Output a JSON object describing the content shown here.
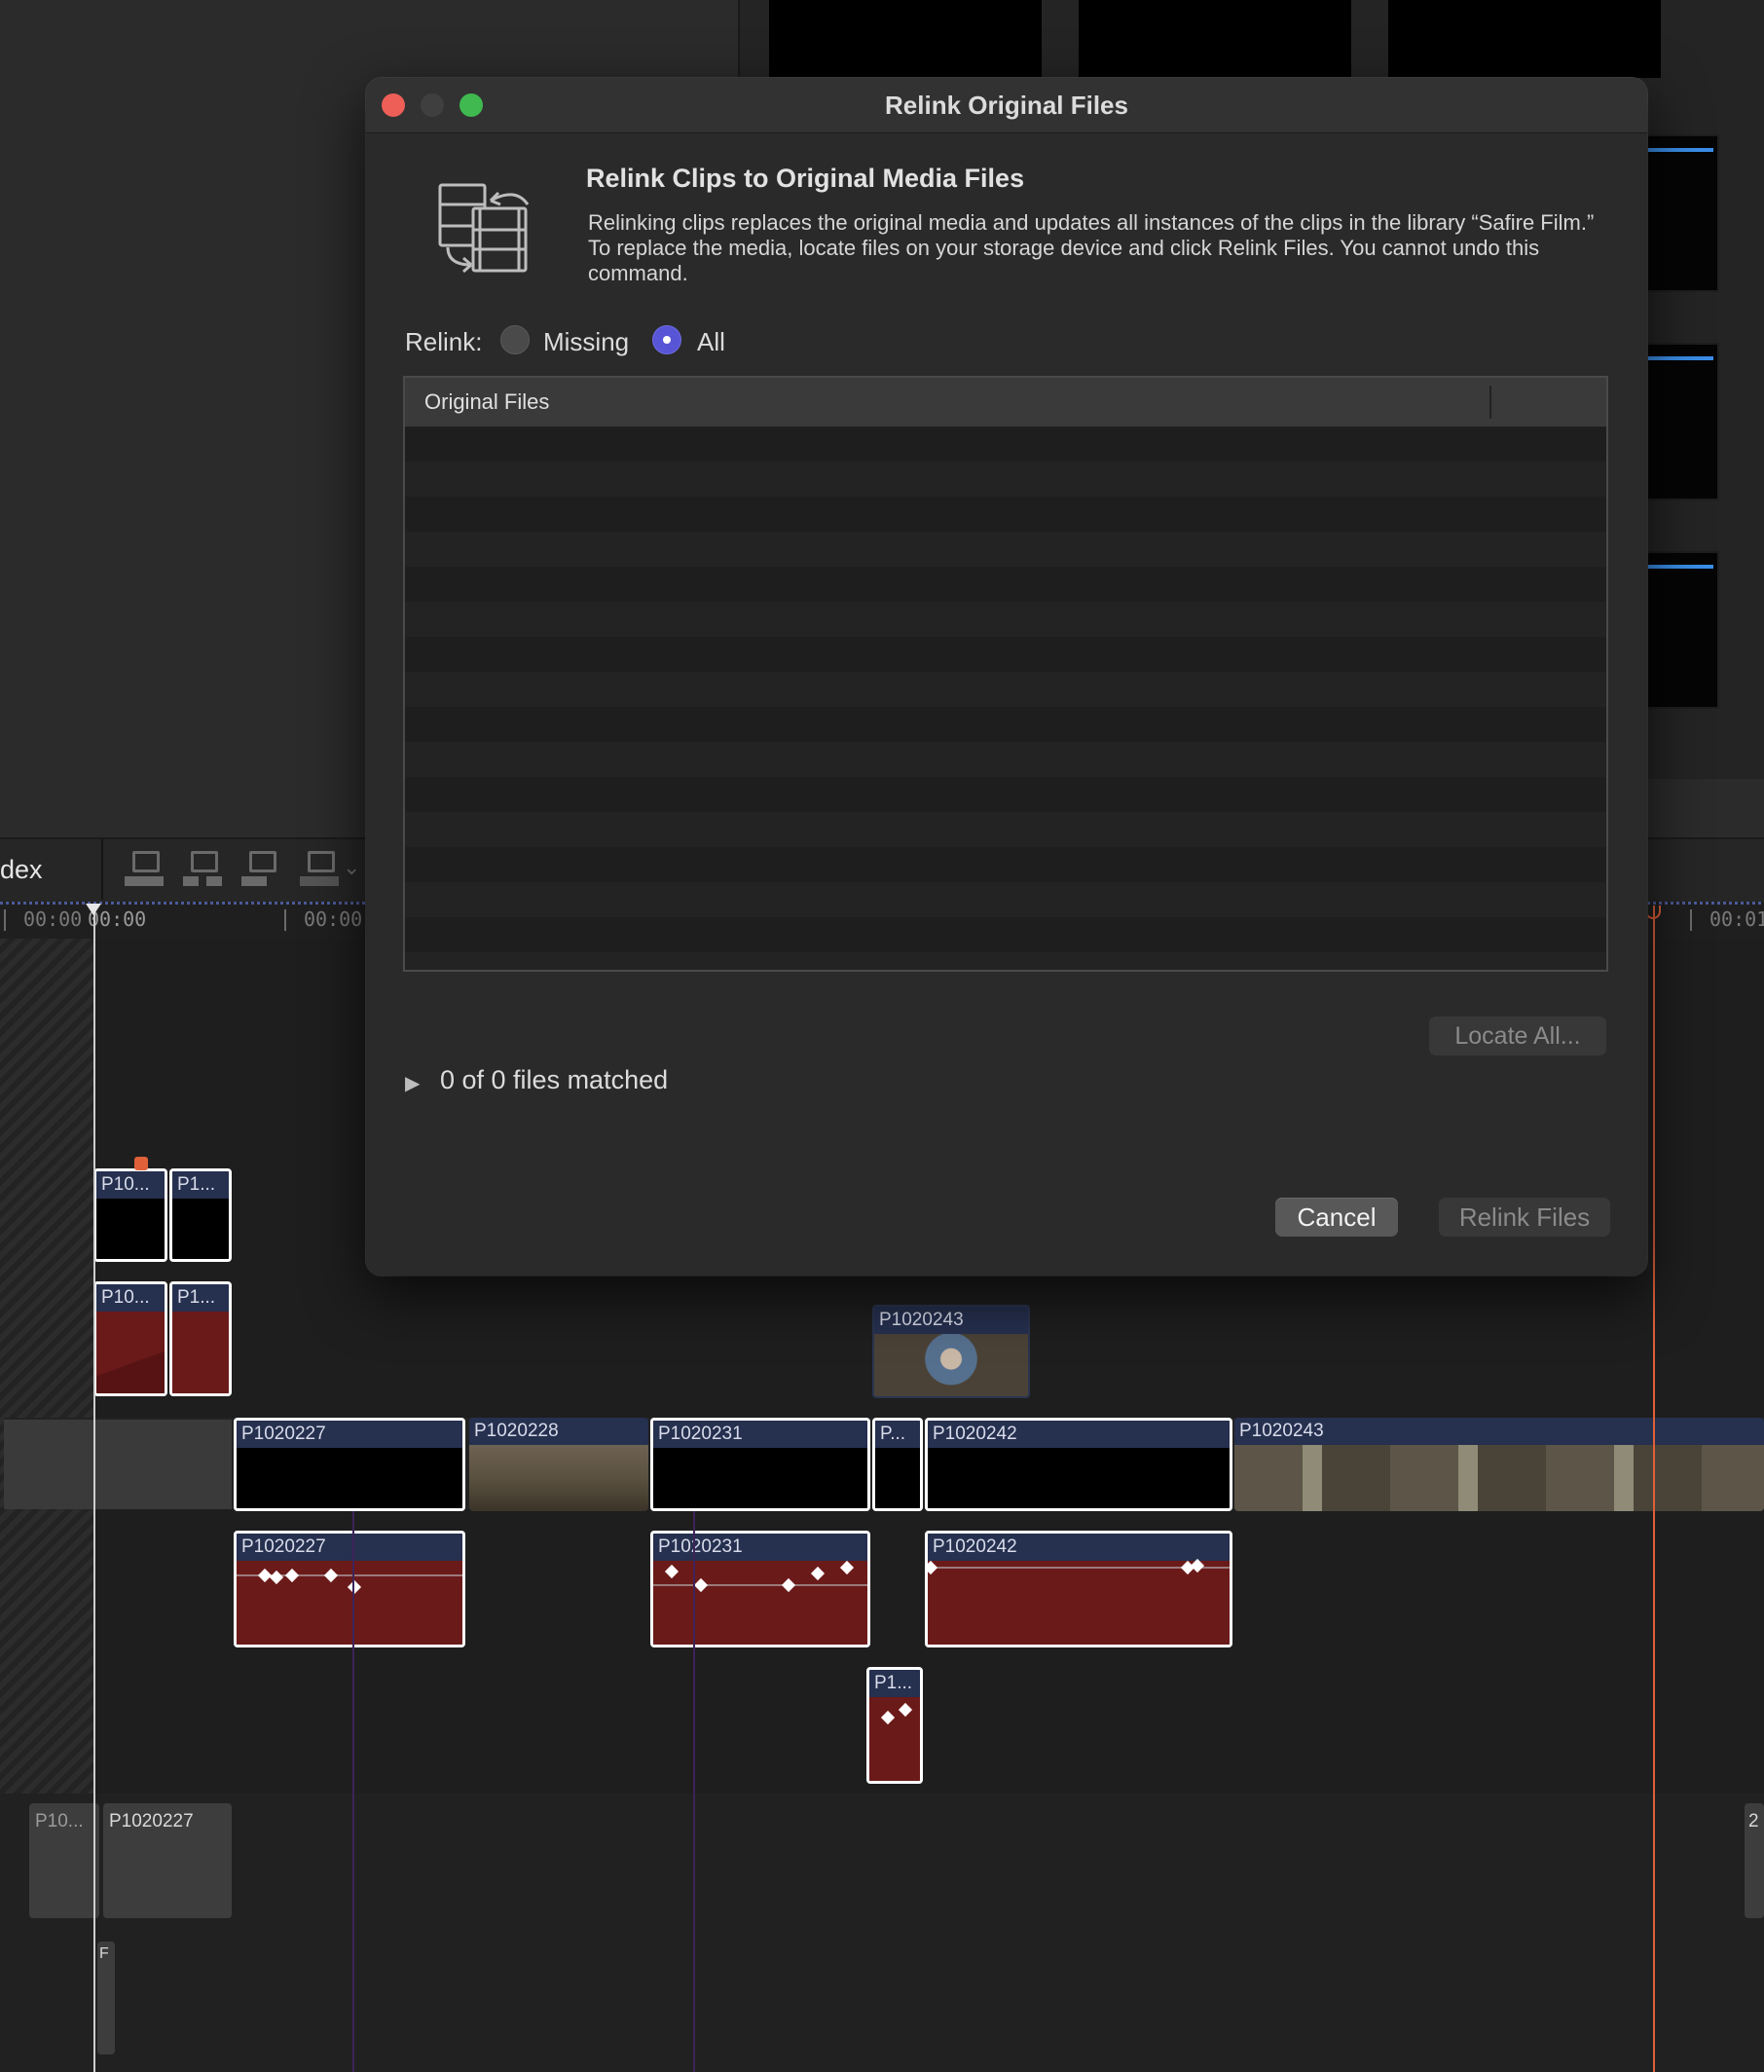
{
  "background": {
    "toolbar": {
      "index_label": "dex"
    },
    "ruler": {
      "tc_left": "00:00",
      "tc_playhead": "00:00",
      "tc_mid": "00:00:",
      "tc_right": "00:01"
    },
    "clips": {
      "conn_top_1": "P10...",
      "conn_top_2": "P1...",
      "conn_audio_1": "P10...",
      "conn_audio_2": "P1...",
      "floating": "P1020243",
      "main_1": "P1020227",
      "main_2": "P1020228",
      "main_3": "P1020231",
      "main_4": "P...",
      "main_5": "P1020242",
      "main_6": "P1020243",
      "audio_1": "P1020227",
      "audio_2": "P1020231",
      "audio_3": "P1020242",
      "audio_small": "P1...",
      "lower_1": "P10...",
      "lower_2": "P1020227",
      "lower_3": "F",
      "lower_right": "2"
    },
    "colors": {
      "playhead": "#e0603a",
      "accent_blue": "#3a8ee8",
      "audio_clip": "#6b1a1a",
      "selection": "#ffffff"
    }
  },
  "dialog": {
    "title": "Relink Original Files",
    "heading": "Relink Clips to Original Media Files",
    "description": "Relinking clips replaces the original media and updates all instances of the clips in the library “Safire Film.” To replace the media, locate files on your storage device and click Relink Files. You cannot undo this command.",
    "icon": "relink-filmstrip-icon",
    "relink_label": "Relink:",
    "relink_options": [
      {
        "label": "Missing",
        "selected": false
      },
      {
        "label": "All",
        "selected": true
      }
    ],
    "table": {
      "column_header": "Original Files",
      "rows": []
    },
    "locate_all_button": "Locate All...",
    "match_status": "0 of 0 files matched",
    "cancel_button": "Cancel",
    "relink_button": "Relink Files",
    "traffic_lights": {
      "close": "#ed5f57",
      "minimize": "#3f3f3f",
      "zoom": "#3fb950"
    }
  }
}
